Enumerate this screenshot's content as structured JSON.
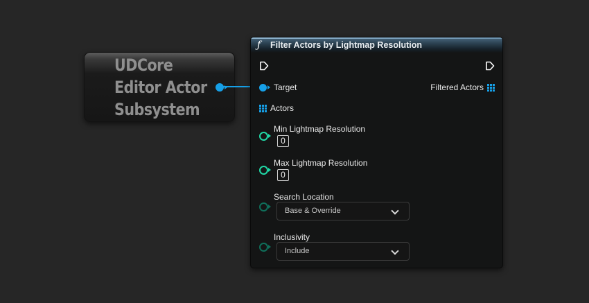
{
  "subsystem_node": {
    "title_lines": [
      "UDCore",
      "Editor Actor",
      "Subsystem"
    ]
  },
  "function_node": {
    "function_icon": "ƒ",
    "title": "Filter Actors by Lightmap Resolution",
    "inputs": {
      "target": {
        "label": "Target"
      },
      "actors": {
        "label": "Actors"
      },
      "min_lightmap": {
        "label": "Min Lightmap Resolution",
        "value": "0"
      },
      "max_lightmap": {
        "label": "Max Lightmap Resolution",
        "value": "0"
      },
      "search_location": {
        "label": "Search Location",
        "selected": "Base & Override"
      },
      "inclusivity": {
        "label": "Inclusivity",
        "selected": "Include"
      }
    },
    "outputs": {
      "filtered_actors": {
        "label": "Filtered Actors"
      }
    }
  },
  "icons": {
    "exec_in": "exec-triangle-icon",
    "exec_out": "exec-triangle-icon",
    "object_pin": "object-pin-icon",
    "array_pin": "array-grid-icon",
    "int_pin": "int-pin-icon",
    "enum_pin": "enum-pin-icon",
    "dropdown": "chevron-down-icon"
  },
  "colors": {
    "background": "#262626",
    "object_pin": "#16a0e8",
    "int_pin": "#20d8a6",
    "enum_pin": "#0f6e5a",
    "header": "#2e4556"
  }
}
